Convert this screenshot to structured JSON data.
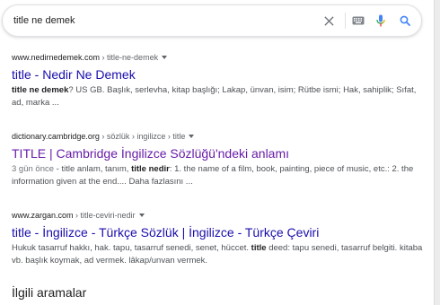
{
  "search": {
    "query": "title ne demek"
  },
  "icons": {
    "clear": "close-icon",
    "keyboard": "keyboard-icon",
    "voice": "microphone-icon",
    "search": "search-icon"
  },
  "colors": {
    "link": "#1a0dab",
    "visited": "#681da8",
    "mic_blue": "#4285f4",
    "mic_red": "#ea4335",
    "mic_yellow": "#fbbc05",
    "mic_green": "#34a853"
  },
  "results": [
    {
      "site": "www.nedirnedemek.com",
      "path": " › title-ne-demek",
      "title": "title - Nedir Ne Demek",
      "snippet": [
        {
          "t": "title ne demek",
          "b": true
        },
        {
          "t": "? US GB. Başlık, serlevha, kitap başlığı; Lakap, ünvan, isim; Rütbe ismi; Hak, sahiplik; Sıfat, ad, marka ...",
          "b": false
        }
      ]
    },
    {
      "site": "dictionary.cambridge.org",
      "path": " › sözlük › ingilizce › title",
      "title": "TITLE | Cambridge İngilizce Sözlüğü'ndeki anlamı",
      "date": "3 gün önce",
      "snippet": [
        {
          "t": " - title anlam, tanım, ",
          "b": false
        },
        {
          "t": "title nedir",
          "b": true
        },
        {
          "t": ": 1. the name of a film, book, painting, piece of music, etc.: 2. the information given at the end.... Daha fazlasını ...",
          "b": false
        }
      ]
    },
    {
      "site": "www.zargan.com",
      "path": " › title-ceviri-nedir",
      "title": "title - İngilizce - Türkçe Sözlük | İngilizce - Türkçe Çeviri",
      "snippet": [
        {
          "t": "Hukuk tasarruf hakkı, hak. tapu, tasarruf senedi, senet, hüccet. ",
          "b": false
        },
        {
          "t": "title",
          "b": true
        },
        {
          "t": " deed: tapu senedi, tasarruf belgiti. kitaba vb. başlık koymak, ad vermek. lâkap/unvan vermek.",
          "b": false
        }
      ]
    }
  ],
  "related": {
    "heading": "İlgili aramalar"
  }
}
